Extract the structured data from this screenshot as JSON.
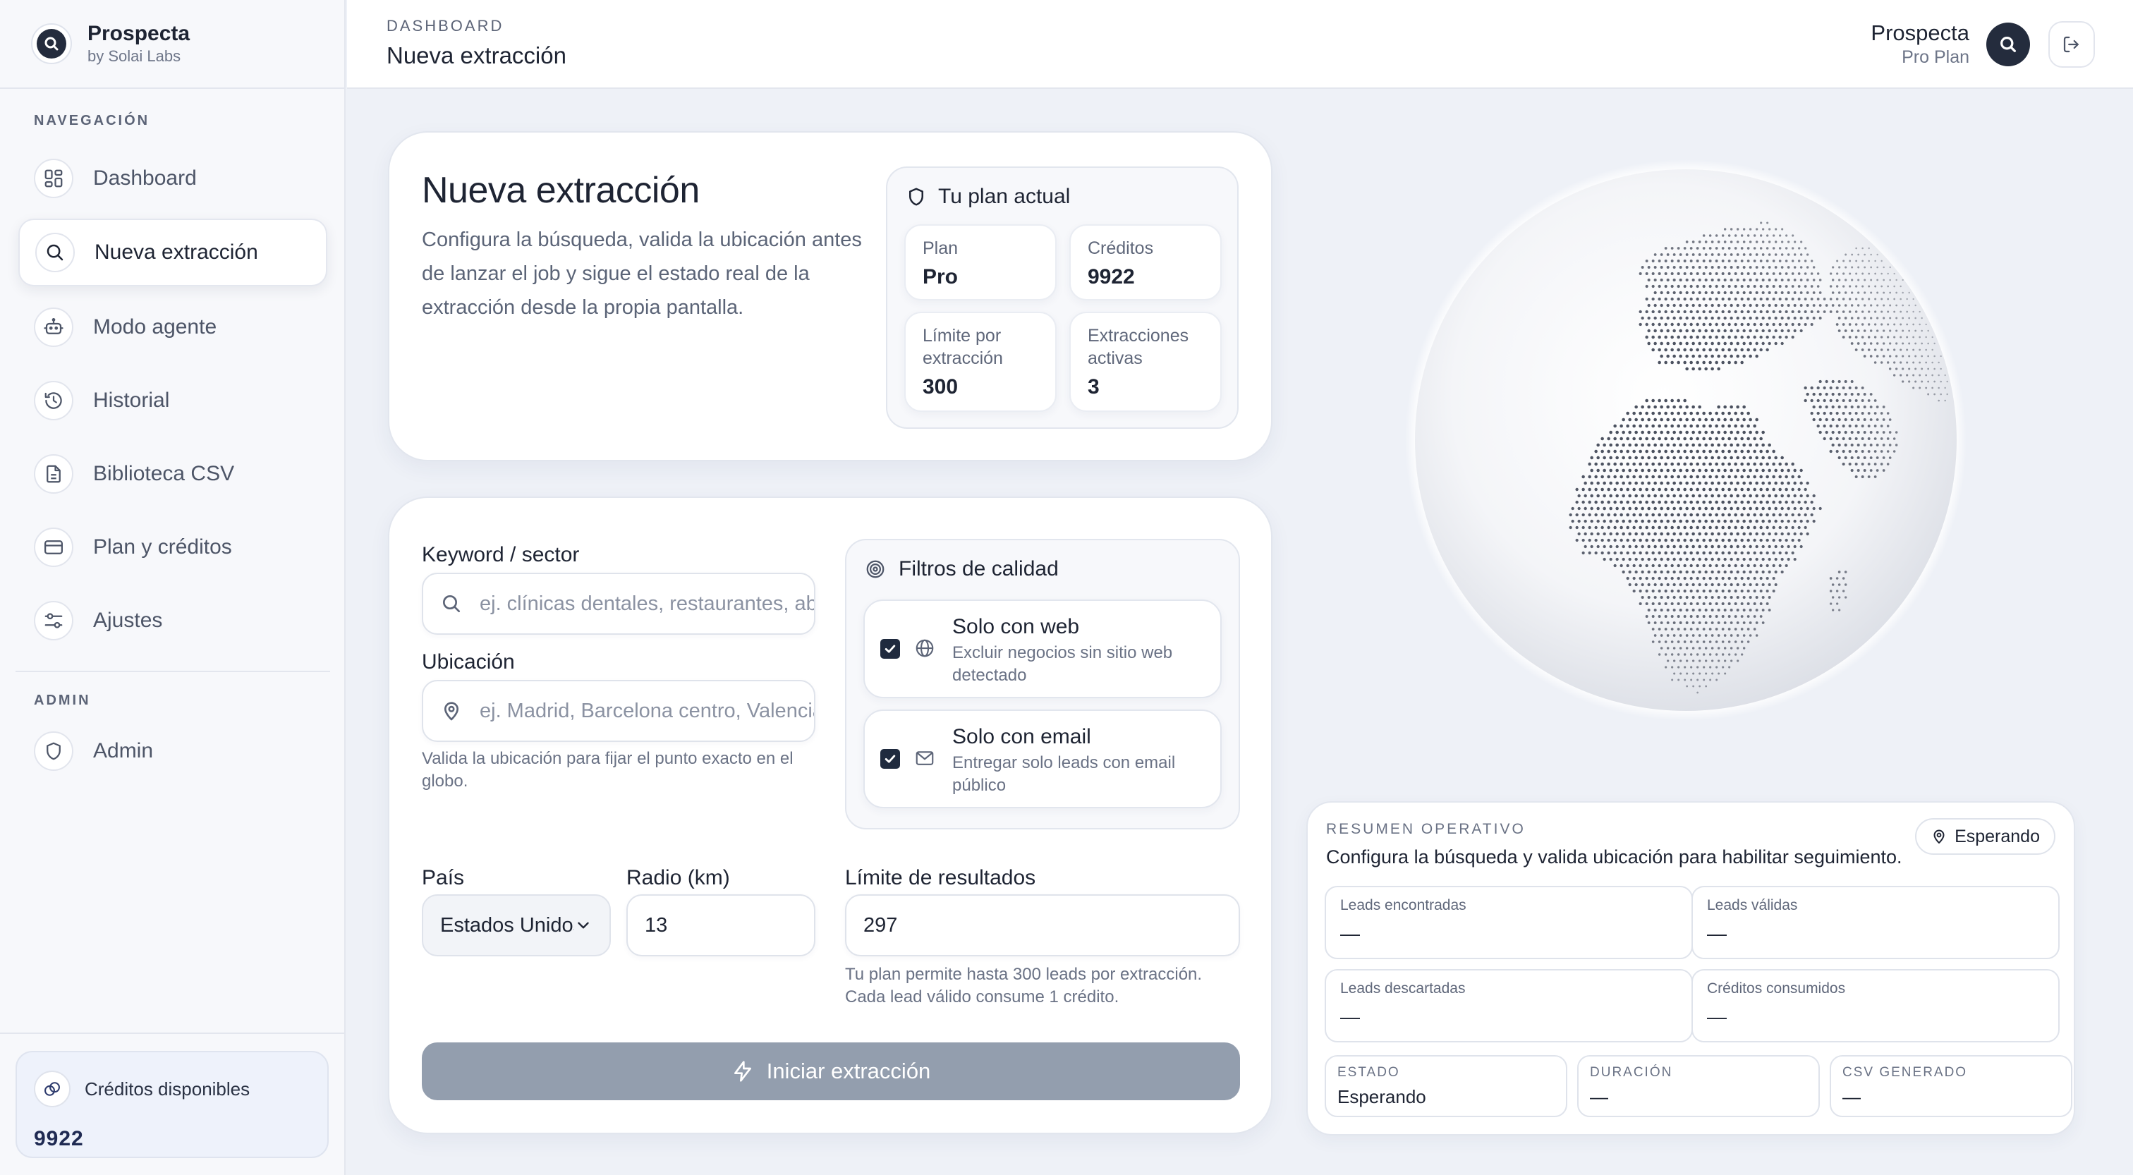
{
  "brand": {
    "name": "Prospecta",
    "sub": "by Solai Labs"
  },
  "sidebar": {
    "nav_label": "NAVEGACIÓN",
    "items": [
      {
        "label": "Dashboard",
        "icon": "grid-icon"
      },
      {
        "label": "Nueva extracción",
        "icon": "search-icon"
      },
      {
        "label": "Modo agente",
        "icon": "robot-icon"
      },
      {
        "label": "Historial",
        "icon": "history-icon"
      },
      {
        "label": "Biblioteca CSV",
        "icon": "file-icon"
      },
      {
        "label": "Plan y créditos",
        "icon": "credit-card-icon"
      },
      {
        "label": "Ajustes",
        "icon": "sliders-icon"
      }
    ],
    "admin_label": "ADMIN",
    "admin_item": {
      "label": "Admin",
      "icon": "shield-icon"
    },
    "credits": {
      "label": "Créditos disponibles",
      "value": "9922"
    }
  },
  "header": {
    "crumb": "DASHBOARD",
    "title": "Nueva extracción",
    "user_name": "Prospecta",
    "user_plan": "Pro Plan"
  },
  "intro": {
    "title": "Nueva extracción",
    "description": "Configura la búsqueda, valida la ubicación antes de lanzar el job y sigue el estado real de la extracción desde la propia pantalla.",
    "plan": {
      "heading": "Tu plan actual",
      "stats": [
        {
          "label": "Plan",
          "value": "Pro"
        },
        {
          "label": "Créditos",
          "value": "9922"
        },
        {
          "label": "Límite por extracción",
          "value": "300"
        },
        {
          "label": "Extracciones activas",
          "value": "3"
        }
      ]
    }
  },
  "form": {
    "keyword_label": "Keyword / sector",
    "keyword_placeholder": "ej. clínicas dentales, restaurantes, abogados",
    "location_label": "Ubicación",
    "location_placeholder": "ej. Madrid, Barcelona centro, Valencia",
    "location_helper": "Valida la ubicación para fijar el punto exacto en el globo.",
    "filters": {
      "heading": "Filtros de calidad",
      "options": [
        {
          "title": "Solo con web",
          "desc": "Excluir negocios sin sitio web detectado",
          "checked": true
        },
        {
          "title": "Solo con email",
          "desc": "Entregar solo leads con email público",
          "checked": true
        }
      ]
    },
    "country_label": "País",
    "country_value": "Estados Unidos",
    "radius_label": "Radio (km)",
    "radius_value": "13",
    "limit_label": "Límite de resultados",
    "limit_value": "297",
    "limit_helper": "Tu plan permite hasta 300 leads por extracción. Cada lead válido consume 1 crédito.",
    "start_label": "Iniciar extracción"
  },
  "summary": {
    "label": "RESUMEN OPERATIVO",
    "description": "Configura la búsqueda y valida ubicación para habilitar seguimiento.",
    "status": "Esperando",
    "metrics": [
      {
        "label": "Leads encontradas",
        "value": "—"
      },
      {
        "label": "Leads válidas",
        "value": "—"
      },
      {
        "label": "Leads descartadas",
        "value": "—"
      },
      {
        "label": "Créditos consumidos",
        "value": "—"
      }
    ],
    "mini": [
      {
        "label": "ESTADO",
        "value": "Esperando"
      },
      {
        "label": "DURACIÓN",
        "value": "—"
      },
      {
        "label": "CSV GENERADO",
        "value": "—"
      }
    ]
  },
  "colors": {
    "accent_dark": "#242c3d",
    "button_disabled": "#939eae",
    "background": "#eef1f7"
  }
}
